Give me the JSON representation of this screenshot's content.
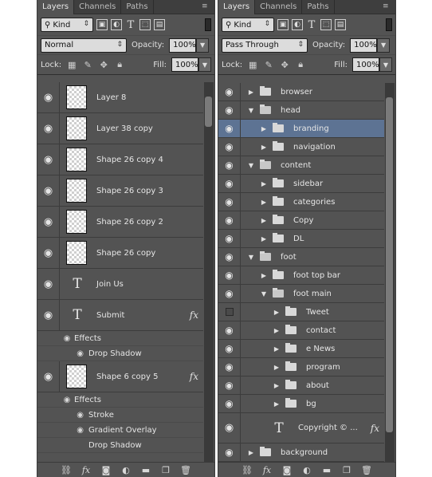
{
  "left": {
    "tabs": [
      "Layers",
      "Channels",
      "Paths"
    ],
    "filter_kind": "Kind",
    "blend_mode": "Normal",
    "opacity_label": "Opacity:",
    "opacity_value": "100%",
    "lock_label": "Lock:",
    "fill_label": "Fill:",
    "fill_value": "100%",
    "layers": {
      "l0": "Layer 8",
      "l1": "Layer 38 copy",
      "l2": "Shape 26 copy 4",
      "l3": "Shape 26 copy 3",
      "l4": "Shape 26 copy 2",
      "l5": "Shape 26 copy",
      "l6": "Join Us",
      "l7": "Submit",
      "l8": "Shape 6 copy 5"
    },
    "effects": {
      "effects_label": "Effects",
      "drop_shadow": "Drop Shadow",
      "stroke": "Stroke",
      "gradient_overlay": "Gradient Overlay"
    },
    "fx": "fx"
  },
  "right": {
    "tabs": [
      "Layers",
      "Channels",
      "Paths"
    ],
    "filter_kind": "Kind",
    "blend_mode": "Pass Through",
    "opacity_label": "Opacity:",
    "opacity_value": "100%",
    "lock_label": "Lock:",
    "fill_label": "Fill:",
    "fill_value": "100%",
    "groups": {
      "g0": "browser",
      "g1": "head",
      "g2": "branding",
      "g3": "navigation",
      "g4": "content",
      "g5": "sidebar",
      "g6": "categories",
      "g7": "Copy",
      "g8": "DL",
      "g9": "foot",
      "g10": "foot top bar",
      "g11": "foot main",
      "g12": "Tweet",
      "g13": "contact",
      "g14": "e News",
      "g15": "program",
      "g16": "about",
      "g17": "bg",
      "g18": "Copyright © ...",
      "g19": "background"
    },
    "fx": "fx"
  },
  "colors": {
    "panel_bg": "#535353",
    "selected_row": "#5d7393"
  }
}
